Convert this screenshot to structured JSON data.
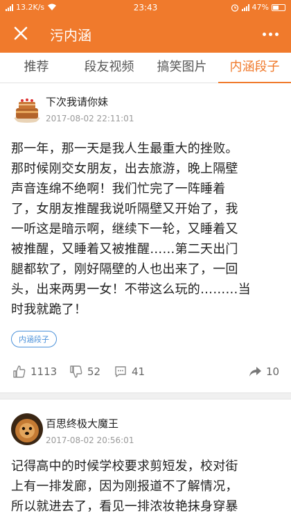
{
  "status_bar": {
    "network_speed": "13.2K/s",
    "time": "23:43",
    "battery": "47%"
  },
  "header": {
    "title": "污内涵",
    "close_icon": "close-icon",
    "more_icon": "more-dots-icon"
  },
  "tabs": [
    {
      "label": "推荐",
      "active": false
    },
    {
      "label": "段友视频",
      "active": false
    },
    {
      "label": "搞笑图片",
      "active": false
    },
    {
      "label": "内涵段子",
      "active": true
    }
  ],
  "posts": [
    {
      "username": "下次我请你妹",
      "time": "2017-08-02 22:11:01",
      "lines": [
        "那一年，那一天是我人生最重大的挫败。",
        "那时候刚交女朋友，出去旅游，晚上隔壁",
        "声音连绵不绝啊！我们忙完了一阵睡着",
        "了，女朋友推醒我说听隔壁又开始了，我",
        "一听这是暗示啊，继续下一轮，又睡着又",
        "被推醒，又睡着又被推醒……第二天出门",
        "腿都软了，刚好隔壁的人也出来了，一回",
        "头，出来两男一女！不带这么玩的………当",
        "时我就跪了！"
      ],
      "tag": "内涵段子",
      "likes": "1113",
      "dislikes": "52",
      "comments": "41",
      "shares": "10"
    },
    {
      "username": "百思终极大魔王",
      "time": "2017-08-02 20:56:01",
      "lines": [
        "记得高中的时候学校要求剪短发，校对街",
        "上有一排发廊，因为刚报道不了解情况，",
        "所以就进去了，看见一排浓妆艳抹身穿暴"
      ]
    }
  ],
  "colors": {
    "accent": "#f07a2c",
    "tag_blue": "#4a90d9"
  }
}
